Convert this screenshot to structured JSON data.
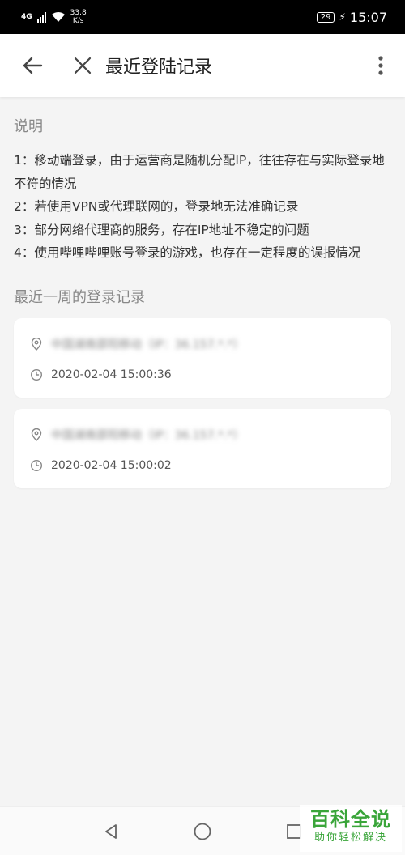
{
  "status": {
    "network_type": "4G",
    "speed_value": "33.8",
    "speed_unit": "K/s",
    "battery": "29",
    "time": "15:07"
  },
  "app_bar": {
    "title": "最近登陆记录"
  },
  "notes": {
    "title": "说明",
    "items": [
      "1：移动端登录，由于运营商是随机分配IP，往往存在与实际登录地不符的情况",
      "2：若使用VPN或代理联网的，登录地无法准确记录",
      "3：部分网络代理商的服务，存在IP地址不稳定的问题",
      "4：使用哔哩哔哩账号登录的游戏，也存在一定程度的误报情况"
    ]
  },
  "records": {
    "title": "最近一周的登录记录",
    "items": [
      {
        "location": "中国湖南邵阳移动（IP：36.157.*.*）",
        "time": "2020-02-04 15:00:36"
      },
      {
        "location": "中国湖南邵阳移动（IP：36.157.*.*）",
        "time": "2020-02-04 15:00:02"
      }
    ]
  },
  "watermark": {
    "main": "百科全说",
    "sub": "助你轻松解决"
  },
  "colors": {
    "background": "#f4f4f4",
    "card": "#ffffff",
    "watermark_green": "#3aa53a"
  }
}
